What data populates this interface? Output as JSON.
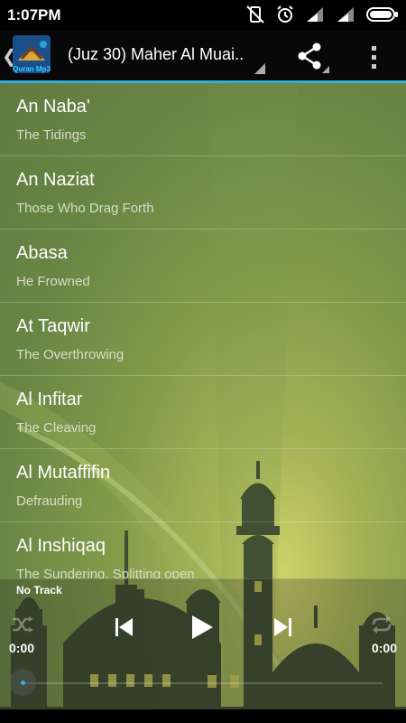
{
  "status_bar": {
    "time": "1:07PM"
  },
  "action_bar": {
    "app_icon_text": "Quran Mp3",
    "title": "(Juz 30) Maher Al Muai.."
  },
  "surahs": [
    {
      "name": "An Naba'",
      "meaning": "The Tidings"
    },
    {
      "name": "An Naziat",
      "meaning": "Those Who Drag Forth"
    },
    {
      "name": "Abasa",
      "meaning": "He Frowned"
    },
    {
      "name": "At Taqwir",
      "meaning": "The Overthrowing"
    },
    {
      "name": "Al Infitar",
      "meaning": "The Cleaving"
    },
    {
      "name": "Al Mutaffifin",
      "meaning": "Defrauding"
    },
    {
      "name": "Al Inshiqaq",
      "meaning": "The Sundering, Splitting open"
    }
  ],
  "player": {
    "track_label": "No Track",
    "time_elapsed": "0:00",
    "time_total": "0:00",
    "progress": 0
  },
  "colors": {
    "accent": "#33aee0",
    "bg_green": "#6a8644"
  }
}
